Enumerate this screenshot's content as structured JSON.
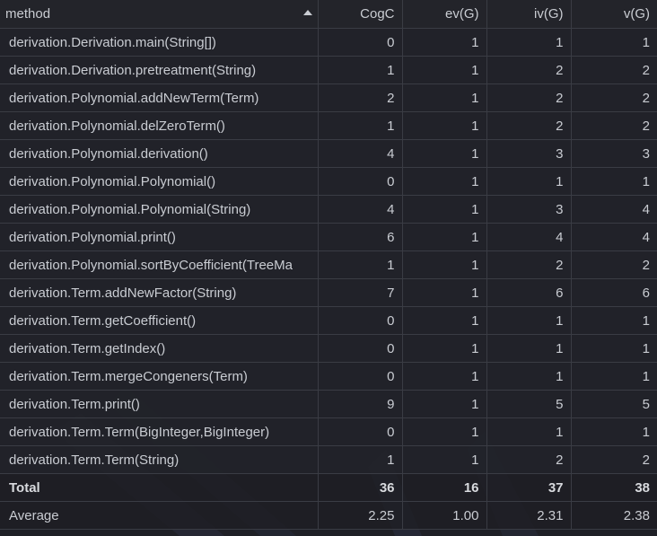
{
  "headers": {
    "method": "method",
    "cogc": "CogC",
    "ev": "ev(G)",
    "iv": "iv(G)",
    "v": "v(G)"
  },
  "rows": [
    {
      "method": "derivation.Derivation.main(String[])",
      "cogc": "0",
      "ev": "1",
      "iv": "1",
      "v": "1"
    },
    {
      "method": "derivation.Derivation.pretreatment(String)",
      "cogc": "1",
      "ev": "1",
      "iv": "2",
      "v": "2"
    },
    {
      "method": "derivation.Polynomial.addNewTerm(Term)",
      "cogc": "2",
      "ev": "1",
      "iv": "2",
      "v": "2"
    },
    {
      "method": "derivation.Polynomial.delZeroTerm()",
      "cogc": "1",
      "ev": "1",
      "iv": "2",
      "v": "2"
    },
    {
      "method": "derivation.Polynomial.derivation()",
      "cogc": "4",
      "ev": "1",
      "iv": "3",
      "v": "3"
    },
    {
      "method": "derivation.Polynomial.Polynomial()",
      "cogc": "0",
      "ev": "1",
      "iv": "1",
      "v": "1"
    },
    {
      "method": "derivation.Polynomial.Polynomial(String)",
      "cogc": "4",
      "ev": "1",
      "iv": "3",
      "v": "4"
    },
    {
      "method": "derivation.Polynomial.print()",
      "cogc": "6",
      "ev": "1",
      "iv": "4",
      "v": "4"
    },
    {
      "method": "derivation.Polynomial.sortByCoefficient(TreeMa",
      "cogc": "1",
      "ev": "1",
      "iv": "2",
      "v": "2"
    },
    {
      "method": "derivation.Term.addNewFactor(String)",
      "cogc": "7",
      "ev": "1",
      "iv": "6",
      "v": "6"
    },
    {
      "method": "derivation.Term.getCoefficient()",
      "cogc": "0",
      "ev": "1",
      "iv": "1",
      "v": "1"
    },
    {
      "method": "derivation.Term.getIndex()",
      "cogc": "0",
      "ev": "1",
      "iv": "1",
      "v": "1"
    },
    {
      "method": "derivation.Term.mergeCongeners(Term)",
      "cogc": "0",
      "ev": "1",
      "iv": "1",
      "v": "1"
    },
    {
      "method": "derivation.Term.print()",
      "cogc": "9",
      "ev": "1",
      "iv": "5",
      "v": "5"
    },
    {
      "method": "derivation.Term.Term(BigInteger,BigInteger)",
      "cogc": "0",
      "ev": "1",
      "iv": "1",
      "v": "1"
    },
    {
      "method": "derivation.Term.Term(String)",
      "cogc": "1",
      "ev": "1",
      "iv": "2",
      "v": "2"
    }
  ],
  "total": {
    "label": "Total",
    "cogc": "36",
    "ev": "16",
    "iv": "37",
    "v": "38"
  },
  "average": {
    "label": "Average",
    "cogc": "2.25",
    "ev": "1.00",
    "iv": "2.31",
    "v": "2.38"
  },
  "icons": {
    "sort": "sort-ascending-icon"
  },
  "colors": {
    "background": "#1f2026",
    "grid": "#3a3c44",
    "text": "#c9ccd2",
    "accent": "#3d6fb5"
  }
}
